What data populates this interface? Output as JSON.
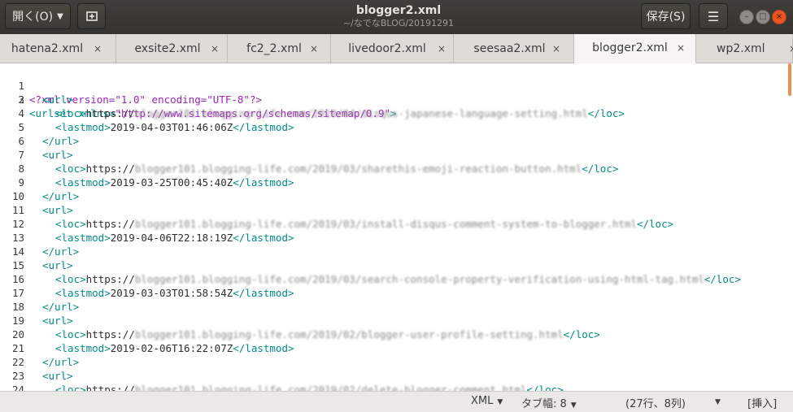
{
  "header": {
    "open_label": "開く(O)",
    "title": "blogger2.xml",
    "subtitle": "~/なでなBLOG/20191291",
    "save_label": "保存(S)"
  },
  "tabs": [
    {
      "label": "hatena2.xml"
    },
    {
      "label": "exsite2.xml"
    },
    {
      "label": "fc2_2.xml"
    },
    {
      "label": "livedoor2.xml"
    },
    {
      "label": "seesaa2.xml"
    },
    {
      "label": "blogger2.xml"
    },
    {
      "label": "wp2.xml"
    }
  ],
  "tab_close": "×",
  "active_tab": "blogger2.xml",
  "editor": {
    "lines": [
      {
        "n": "1",
        "xmldecl_open": "<?xml ",
        "k1": "version=",
        "v1": "\"1.0\"",
        "k2": " encoding=",
        "v2": "\"UTF-8\"",
        "xmldecl_close": "?>"
      },
      {
        "n": "2",
        "open": "<urlset ",
        "k1": "xmlns=",
        "v1": "\"http://www.sitemaps.org/schemas/sitemap/0.9\"",
        "close": ">"
      },
      {
        "n": "3",
        "tag": "<url>"
      },
      {
        "n": "4",
        "url_prefix": "https://",
        "blur": "blogger101.blogging-life.com/2019/04/disqus-japanese-language-setting.html"
      },
      {
        "n": "5",
        "lastmod": "2019-04-03T01:46:06Z"
      },
      {
        "n": "6",
        "tag": "</url>"
      },
      {
        "n": "7",
        "tag": "<url>"
      },
      {
        "n": "8",
        "url_prefix": "https://",
        "blur": "blogger101.blogging-life.com/2019/03/sharethis-emoji-reaction-button.html"
      },
      {
        "n": "9",
        "lastmod": "2019-03-25T00:45:40Z"
      },
      {
        "n": "10",
        "tag": "</url>"
      },
      {
        "n": "11",
        "tag": "<url>"
      },
      {
        "n": "12",
        "url_prefix": "https://",
        "blur": "blogger101.blogging-life.com/2019/03/install-disqus-comment-system-to-blogger.html"
      },
      {
        "n": "13",
        "lastmod": "2019-04-06T22:18:19Z"
      },
      {
        "n": "14",
        "tag": "</url>"
      },
      {
        "n": "15",
        "tag": "<url>"
      },
      {
        "n": "16",
        "url_prefix": "https://",
        "blur": "blogger101.blogging-life.com/2019/03/search-console-property-verification-using-html-tag.html"
      },
      {
        "n": "17",
        "lastmod": "2019-03-03T01:58:54Z"
      },
      {
        "n": "18",
        "tag": "</url>"
      },
      {
        "n": "19",
        "tag": "<url>"
      },
      {
        "n": "20",
        "url_prefix": "https://",
        "blur": "blogger101.blogging-life.com/2019/02/blogger-user-profile-setting.html"
      },
      {
        "n": "21",
        "lastmod": "2019-02-06T16:22:07Z"
      },
      {
        "n": "22",
        "tag": "</url>"
      },
      {
        "n": "23",
        "tag": "<url>"
      },
      {
        "n": "24",
        "url_prefix": "https://",
        "blur": "blogger101.blogging-life.com/2019/02/delete-blogger-comment.html"
      }
    ],
    "loc_open": "<loc>",
    "loc_close": "</loc>",
    "lastmod_open": "<lastmod>",
    "lastmod_close": "</lastmod>"
  },
  "statusbar": {
    "language": "XML",
    "tab_width": "タブ幅: 8",
    "position": "(27行、8列)",
    "insert_mode": "[挿入]"
  },
  "colors": {
    "tag": "#008a8a",
    "decl": "#a020c0",
    "accent": "#e95420"
  }
}
